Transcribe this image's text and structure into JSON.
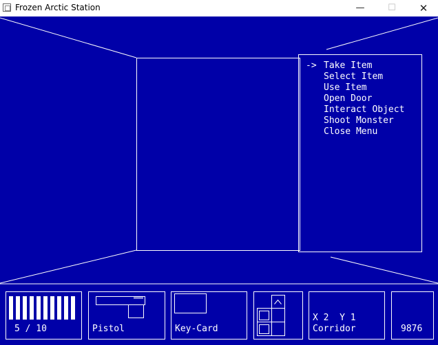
{
  "window": {
    "title": "Frozen Arctic Station",
    "minimize_glyph": "—",
    "maximize_glyph": "☐",
    "close_glyph": "✕"
  },
  "menu": {
    "cursor": "->",
    "selected_index": 0,
    "items": [
      "Take Item",
      "Select Item",
      "Use Item",
      "Open Door",
      "Interact Object",
      "Shoot Monster",
      "Close Menu"
    ]
  },
  "hud": {
    "ammo": {
      "current": 5,
      "max": 10,
      "label": "5 / 10"
    },
    "weapon": {
      "label": "Pistol",
      "icon": "pistol-icon"
    },
    "item": {
      "label": "Key-Card",
      "icon": "key-card-icon"
    },
    "minimap": {
      "icon": "minimap-icon"
    },
    "location": {
      "coords": "X 2  Y 1",
      "name": "Corridor"
    },
    "score": "9876"
  },
  "colors": {
    "background": "#0000a8",
    "line": "#ffffff"
  }
}
